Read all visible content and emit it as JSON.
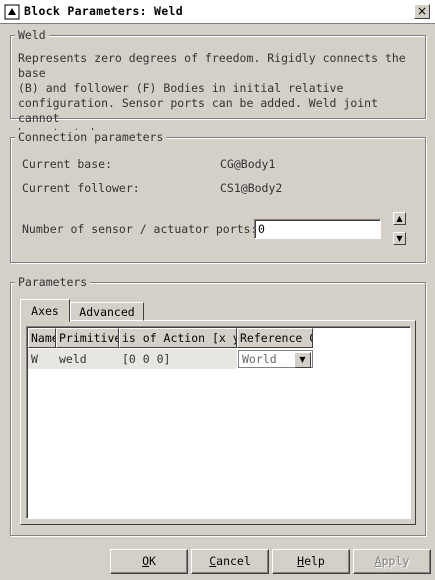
{
  "window": {
    "title": "Block Parameters: Weld",
    "close_label": "×"
  },
  "weld_group": {
    "legend": "Weld",
    "description": "Represents zero degrees of freedom. Rigidly connects the base\n(B) and follower (F) Bodies in initial relative\nconfiguration. Sensor ports can be added. Weld joint cannot\nbe actuated."
  },
  "connection": {
    "legend": "Connection parameters",
    "current_base_label": "Current base:",
    "current_base_value": "CG@Body1",
    "current_follower_label": "Current follower:",
    "current_follower_value": "CS1@Body2",
    "ports_label": "Number of sensor / actuator ports:",
    "ports_value": "0"
  },
  "parameters": {
    "legend": "Parameters",
    "tabs": [
      {
        "label": "Axes"
      },
      {
        "label": "Advanced"
      }
    ],
    "columns": [
      "Name",
      "Primitive",
      "is of Action [x y",
      "Reference C"
    ],
    "rows": [
      {
        "name": "W",
        "primitive": "weld",
        "axis": "[0 0 0]",
        "reference": "World"
      }
    ]
  },
  "buttons": {
    "ok": {
      "accel": "O",
      "rest": "K"
    },
    "cancel": {
      "accel": "C",
      "rest": "ancel"
    },
    "help": {
      "accel": "H",
      "rest": "elp"
    },
    "apply": {
      "accel": "A",
      "rest": "pply"
    }
  }
}
